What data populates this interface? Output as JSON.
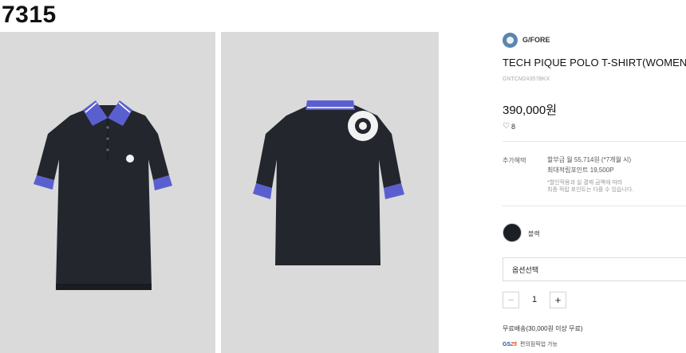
{
  "page_id": "7315",
  "brand": {
    "name": "G/FORE",
    "logo_icon": "brand-logo-icon"
  },
  "product": {
    "title": "TECH PIQUE POLO T-SHIRT(WOMEN)",
    "sku": "GNTCM24357BKX",
    "price": "390,000원",
    "likes": "8",
    "likes_icon": "heart-icon"
  },
  "benefits": {
    "label": "추가혜택",
    "installment": "할부금 월 55,714원 (*7개월 시)",
    "points": "최대적립포인트 19,500P",
    "note_1": "*할인적용과 실 결제 금액에 따라",
    "note_2": "최종 적립 포인트는 다를 수 있습니다."
  },
  "color_option": {
    "label": "블랙",
    "swatch": "#1d1f26"
  },
  "option_select": {
    "placeholder": "옵션선택"
  },
  "quantity": {
    "minus": "−",
    "value": "1",
    "plus": "+"
  },
  "shipping": {
    "text": "무료배송(30,000원 이상 무료)"
  },
  "pickup": {
    "logo_text": "GS",
    "logo_text_accent": "25",
    "text": "편의점픽업 가능"
  },
  "colors": {
    "navy": "#1d1f26",
    "accent_blue": "#5a5fd0",
    "photo_bg": "#dadada"
  }
}
